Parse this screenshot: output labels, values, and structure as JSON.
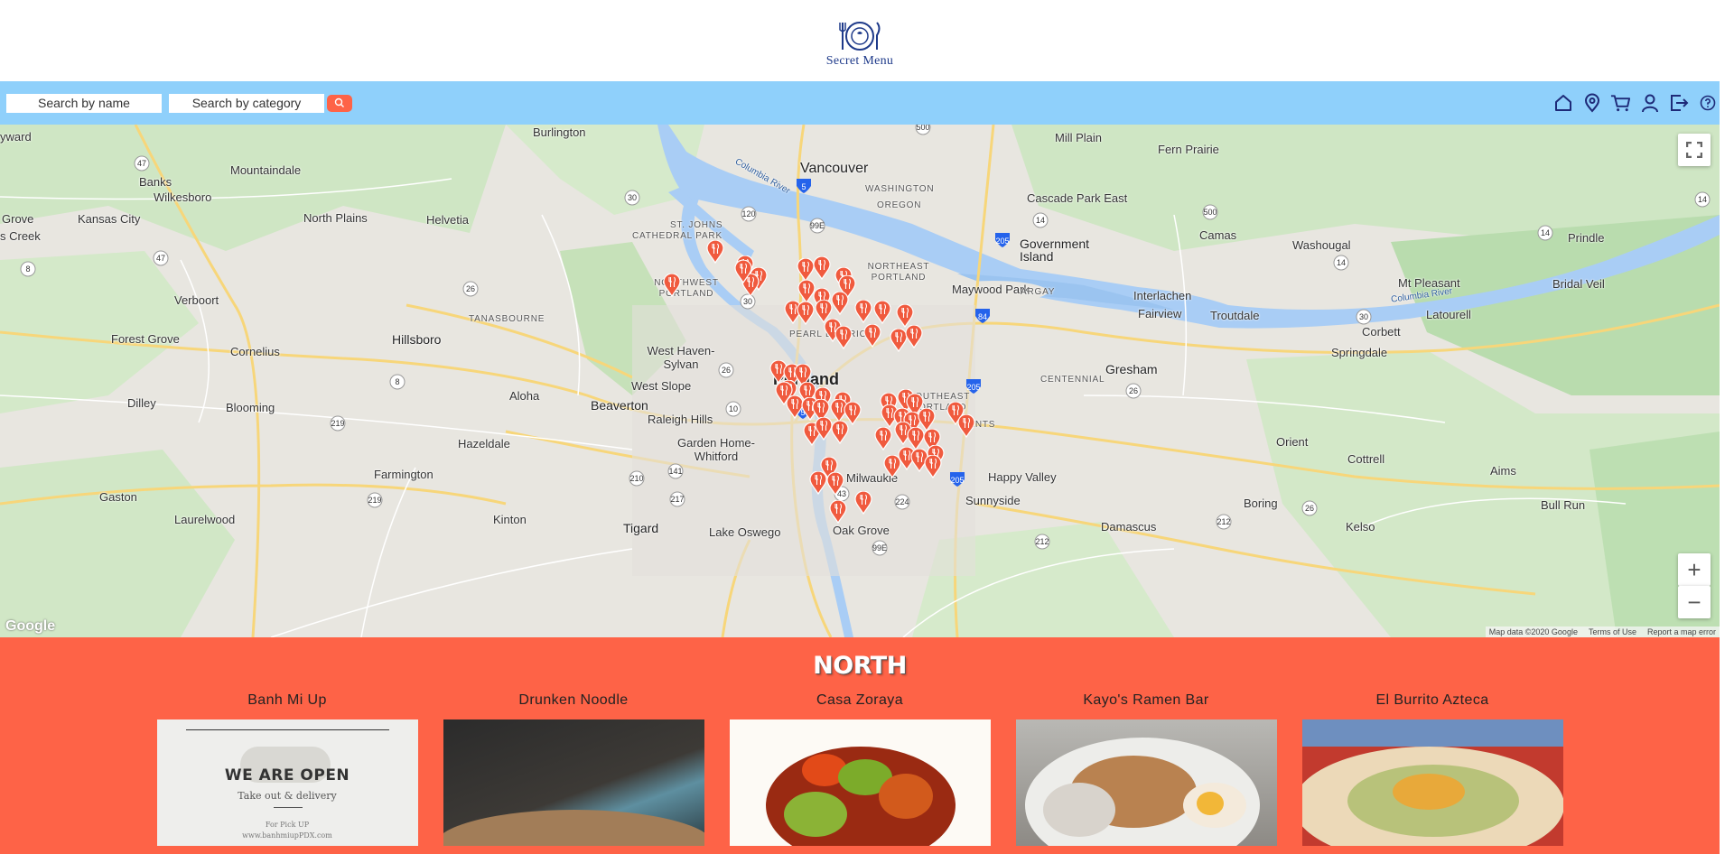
{
  "brand": {
    "name": "Secret Menu"
  },
  "search": {
    "name_placeholder": "Search by name",
    "category_placeholder": "Search by category"
  },
  "nav": {
    "icons": [
      "home-icon",
      "location-pin-icon",
      "cart-icon",
      "user-icon",
      "logout-icon",
      "help-icon"
    ]
  },
  "colors": {
    "accent": "#fe6347",
    "search_bar": "#8fd0fb",
    "brand_text": "#1e3a8a"
  },
  "map": {
    "labels": {
      "vancouver": "Vancouver",
      "washington": "WASHINGTON",
      "oregon": "OREGON",
      "portland": "Portland",
      "hillsboro": "Hillsboro",
      "beaverton": "Beaverton",
      "gresham": "Gresham",
      "tigard": "Tigard",
      "lake_oswego": "Lake Oswego",
      "mountaindale": "Mountaindale",
      "banks": "Banks",
      "wilkesboro": "Wilkesboro",
      "kansas_city": "Kansas City",
      "north_plains": "North Plains",
      "helvetia": "Helvetia",
      "verboort": "Verboort",
      "forest_grove": "Forest Grove",
      "cornelius": "Cornelius",
      "dilley": "Dilley",
      "blooming": "Blooming",
      "aloha": "Aloha",
      "hazeldale": "Hazeldale",
      "farmington": "Farmington",
      "gaston": "Gaston",
      "laurelwood": "Laurelwood",
      "kinton": "Kinton",
      "burlington": "Burlington",
      "mill_plain": "Mill Plain",
      "fern_prairie": "Fern Prairie",
      "cascade_park_east": "Cascade Park East",
      "camas": "Camas",
      "washougal": "Washougal",
      "government_island": "Government Island",
      "maywood_park": "Maywood Park",
      "interlachen": "Interlachen",
      "fairview": "Fairview",
      "troutdale": "Troutdale",
      "corbett": "Corbett",
      "springdale": "Springdale",
      "mt_pleasant": "Mt Pleasant",
      "prindle": "Prindle",
      "bridal_veil": "Bridal Veil",
      "latourell": "Latourell",
      "orient": "Orient",
      "cottrell": "Cottrell",
      "aims": "Aims",
      "bull_run": "Bull Run",
      "boring": "Boring",
      "kelso": "Kelso",
      "damascus": "Damascus",
      "happy_valley": "Happy Valley",
      "sunnyside": "Sunnyside",
      "milwaukie": "Milwaukie",
      "oak_grove": "Oak Grove",
      "garden_home_whitford": "Garden Home-Whitford",
      "raleigh_hills": "Raleigh Hills",
      "west_slope": "West Slope",
      "west_haven_sylvan": "West Haven-Sylvan",
      "st_johns": "ST. JOHNS",
      "cathedral_park": "CATHEDRAL PARK",
      "northwest_portland": "NORTHWEST PORTLAND",
      "northeast_portland": "NORTHEAST PORTLAND",
      "tanasbourne": "TANASBOURNE",
      "argay": "ARGAY",
      "centennial": "CENTENNIAL",
      "southeast_portland": "SOUTHEAST PORTLAND",
      "lents": "LENTS",
      "pearl_district": "PEARL DISTRICT",
      "columbia_river": "Columbia River",
      "columbia_river_east": "Columbia River",
      "yward": "yward",
      "grove": "Grove",
      "s_creek": "s Creek"
    },
    "google_logo": "Google",
    "attribution": [
      "Map data ©2020 Google",
      "Terms of Use",
      "Report a map error"
    ],
    "zoom_in": "+",
    "zoom_out": "−"
  },
  "region": {
    "title": "NORTH",
    "restaurants": [
      {
        "name": "Banh Mi Up",
        "image_caption": "WE ARE OPEN",
        "image_sub": "Take out & delivery",
        "image_small": "For Pick UP",
        "image_url_text": "www.banhmiupPDX.com"
      },
      {
        "name": "Drunken Noodle"
      },
      {
        "name": "Casa Zoraya"
      },
      {
        "name": "Kayo's Ramen Bar"
      },
      {
        "name": "El Burrito Azteca"
      }
    ]
  }
}
